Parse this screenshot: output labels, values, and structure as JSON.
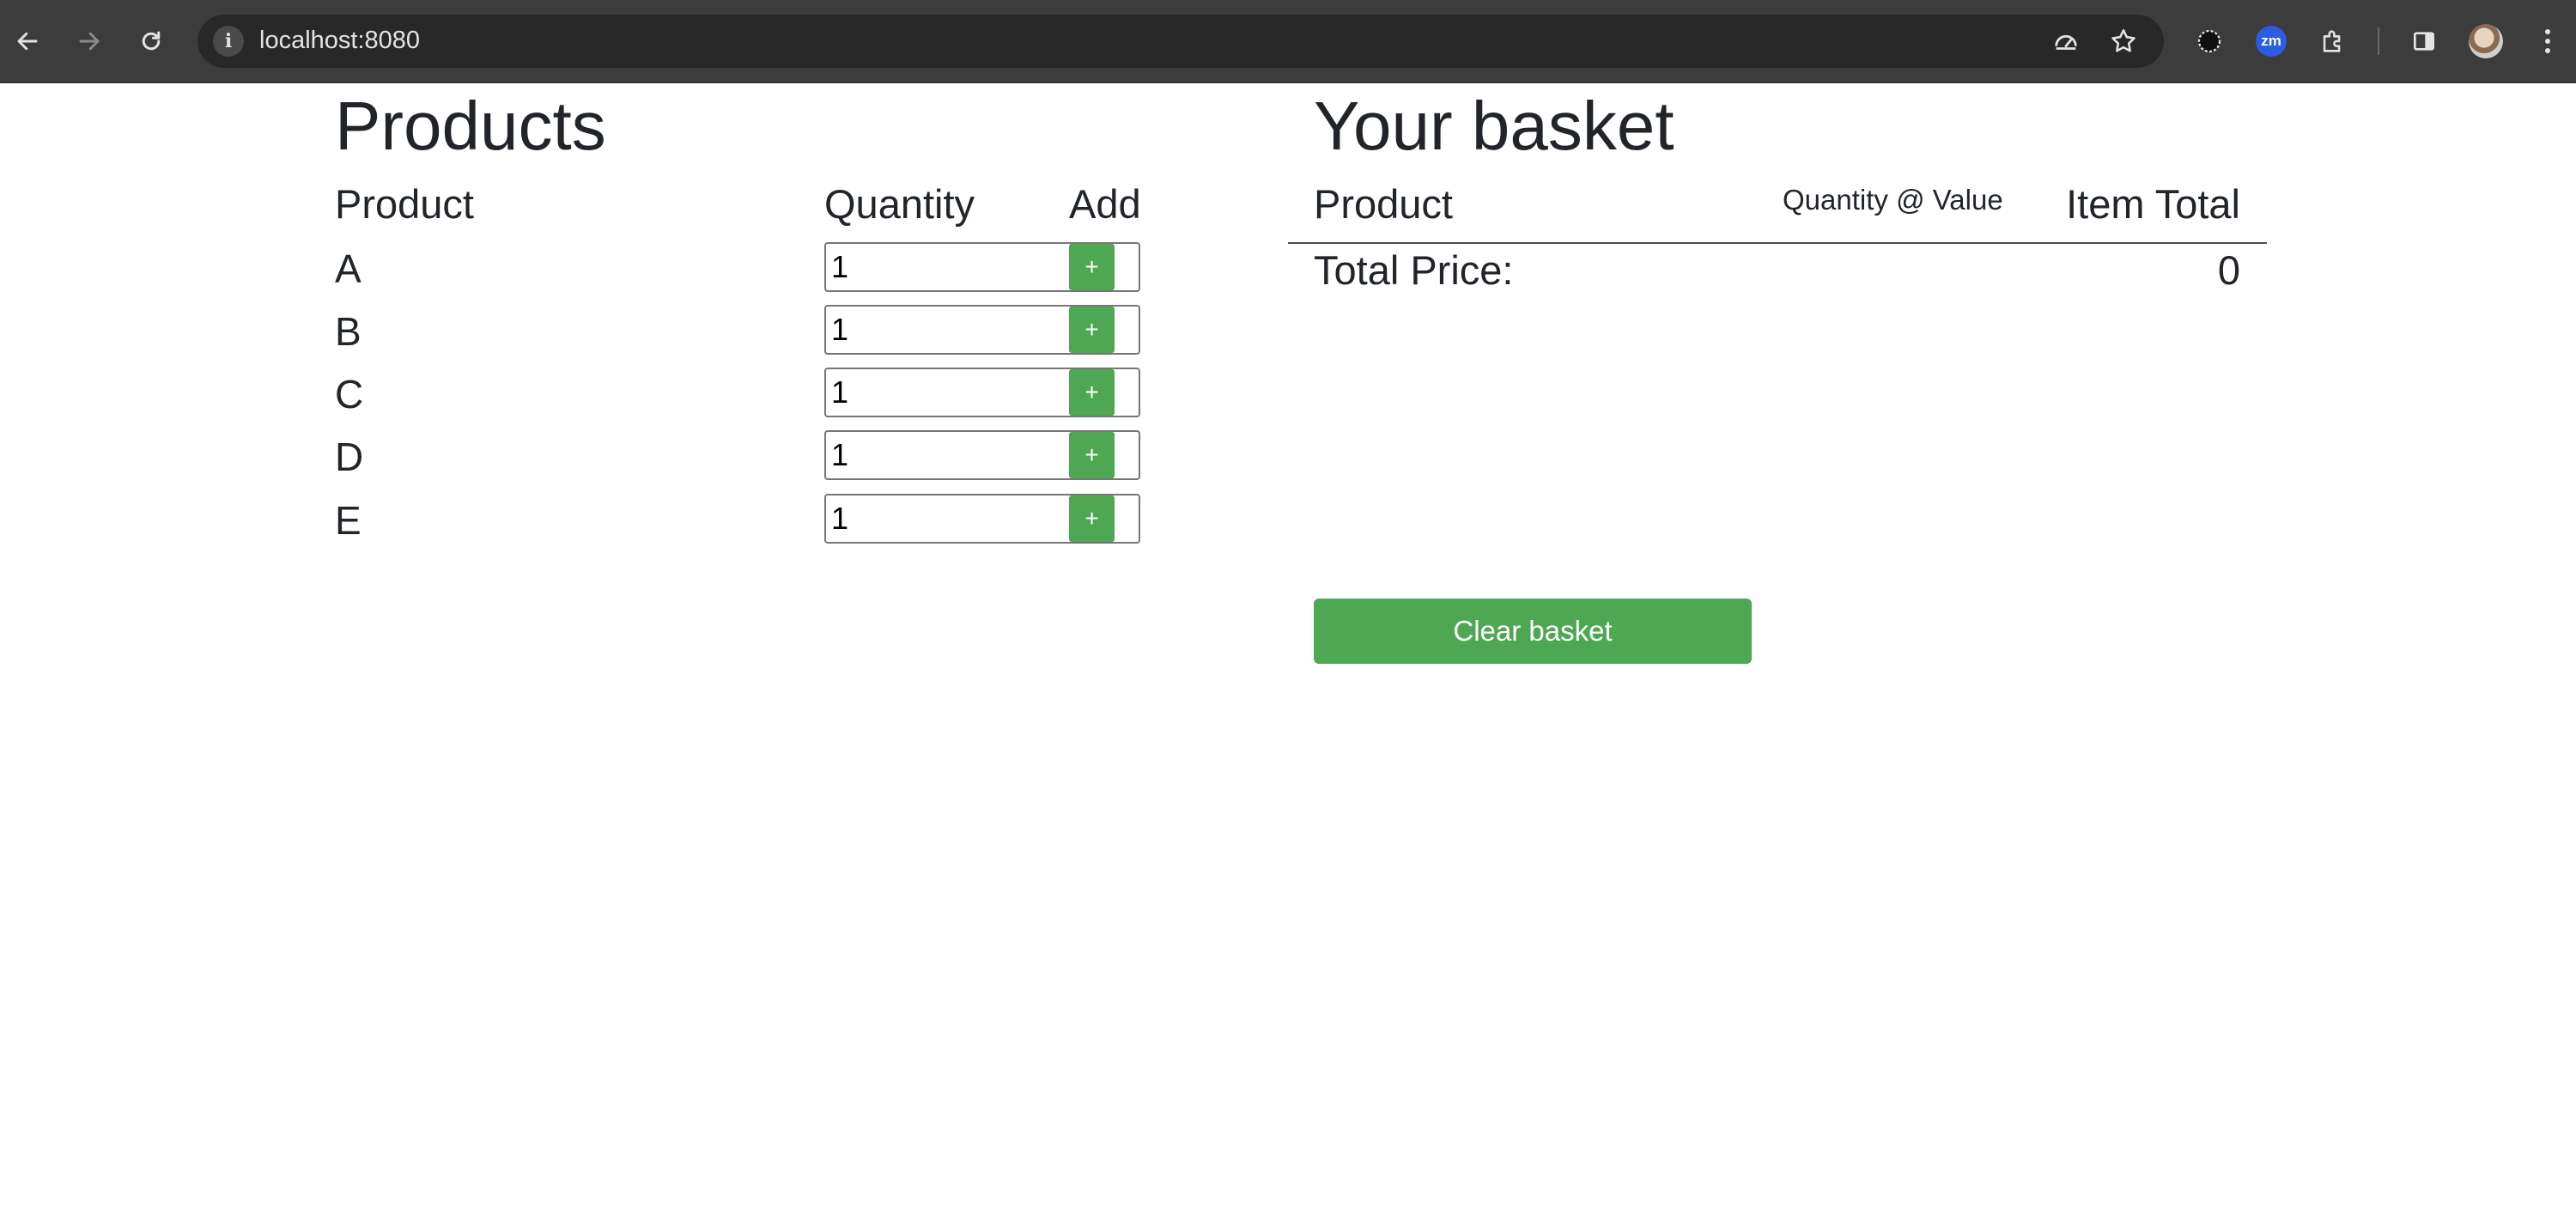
{
  "browser": {
    "url": "localhost:8080",
    "icons": {
      "back": "arrow-left-icon",
      "forward": "arrow-right-icon",
      "reload": "reload-icon",
      "site_info": "info-icon",
      "performance": "speedometer-icon",
      "bookmark": "star-icon",
      "extension_dark": "gear-icon",
      "zoom_extension_label": "zm",
      "extensions": "puzzle-icon",
      "side_panel": "side-panel-icon",
      "menu": "kebab-menu-icon"
    }
  },
  "products": {
    "title": "Products",
    "headers": {
      "product": "Product",
      "quantity": "Quantity",
      "add": "Add"
    },
    "add_label": "+",
    "items": [
      {
        "name": "A",
        "quantity": "1"
      },
      {
        "name": "B",
        "quantity": "1"
      },
      {
        "name": "C",
        "quantity": "1"
      },
      {
        "name": "D",
        "quantity": "1"
      },
      {
        "name": "E",
        "quantity": "1"
      }
    ]
  },
  "basket": {
    "title": "Your basket",
    "headers": {
      "product": "Product",
      "quantity_value": "Quantity @ Value",
      "item_total": "Item Total"
    },
    "total_label": "Total Price:",
    "total_value": "0",
    "clear_label": "Clear basket"
  },
  "colors": {
    "accent_green": "#4ea752",
    "chrome_bg": "#3c3c3c",
    "omnibox_bg": "#282828",
    "text": "#212529"
  }
}
